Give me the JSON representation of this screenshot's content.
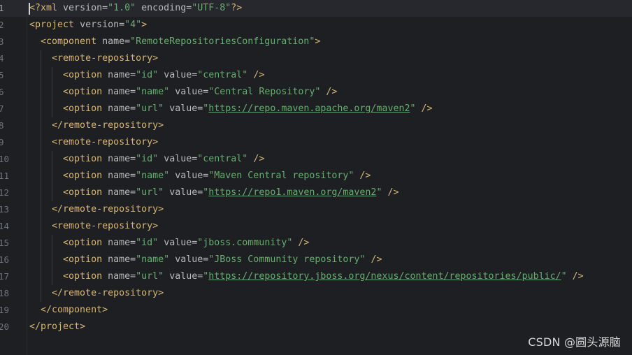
{
  "editor": {
    "language": "xml",
    "colors": {
      "background": "#1e1f22",
      "tag": "#d5b778",
      "attribute": "#bababa",
      "value": "#6aab73",
      "text": "#bcbec4",
      "line_number": "#6f737a"
    },
    "lines": [
      {
        "num": "1",
        "text": "<?xml version=\"1.0\" encoding=\"UTF-8\"?>"
      },
      {
        "num": "2",
        "text": "<project version=\"4\">"
      },
      {
        "num": "3",
        "text": "  <component name=\"RemoteRepositoriesConfiguration\">"
      },
      {
        "num": "4",
        "text": "    <remote-repository>"
      },
      {
        "num": "5",
        "text": "      <option name=\"id\" value=\"central\" />"
      },
      {
        "num": "6",
        "text": "      <option name=\"name\" value=\"Central Repository\" />"
      },
      {
        "num": "7",
        "text": "      <option name=\"url\" value=\"https://repo.maven.apache.org/maven2\" />"
      },
      {
        "num": "8",
        "text": "    </remote-repository>"
      },
      {
        "num": "9",
        "text": "    <remote-repository>"
      },
      {
        "num": "10",
        "text": "      <option name=\"id\" value=\"central\" />"
      },
      {
        "num": "11",
        "text": "      <option name=\"name\" value=\"Maven Central repository\" />"
      },
      {
        "num": "12",
        "text": "      <option name=\"url\" value=\"https://repo1.maven.org/maven2\" />"
      },
      {
        "num": "13",
        "text": "    </remote-repository>"
      },
      {
        "num": "14",
        "text": "    <remote-repository>"
      },
      {
        "num": "15",
        "text": "      <option name=\"id\" value=\"jboss.community\" />"
      },
      {
        "num": "16",
        "text": "      <option name=\"name\" value=\"JBoss Community repository\" />"
      },
      {
        "num": "17",
        "text": "      <option name=\"url\" value=\"https://repository.jboss.org/nexus/content/repositories/public/\" />"
      },
      {
        "num": "18",
        "text": "    </remote-repository>"
      },
      {
        "num": "19",
        "text": "  </component>"
      },
      {
        "num": "20",
        "text": "</project>"
      }
    ],
    "current_line": 1
  },
  "watermark": "CSDN @圆头源脑"
}
